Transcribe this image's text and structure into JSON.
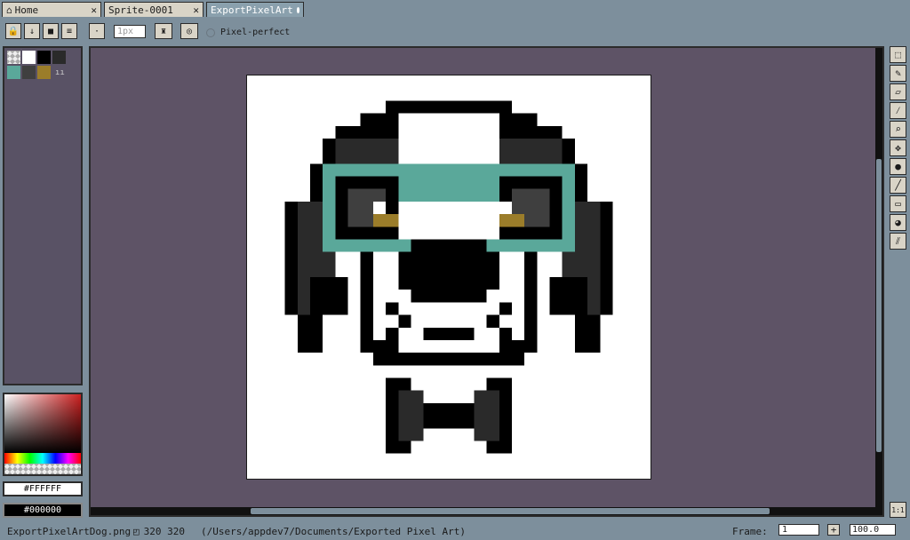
{
  "tabs": [
    {
      "label": "Home",
      "icon": "home-icon"
    },
    {
      "label": "Sprite-0001"
    },
    {
      "label": "ExportPixelArt",
      "active": true
    }
  ],
  "toolbar": {
    "brush_size": "1px",
    "pixel_perfect_label": "Pixel-perfect"
  },
  "palette": {
    "colors": [
      "#ffffff",
      "#000000",
      "#3f3f3f",
      "#5aa89a",
      "#2a2a2a",
      "#9b7d2a"
    ]
  },
  "colors": {
    "foreground_label": "#FFFFFF",
    "background_label": "#000000",
    "glasses": "#5aa89a",
    "eye": "#9b7d2a",
    "dark": "#2a2a2a",
    "lens": "#3f3f3f"
  },
  "status": {
    "filename": "ExportPixelArtDog.png",
    "dimensions": "320 320",
    "path": "(/Users/appdev7/Documents/Exported Pixel Art)",
    "frame_label": "Frame:",
    "frame_value": "1",
    "zoom": "100.0"
  },
  "zoom_button_label": "1:1"
}
